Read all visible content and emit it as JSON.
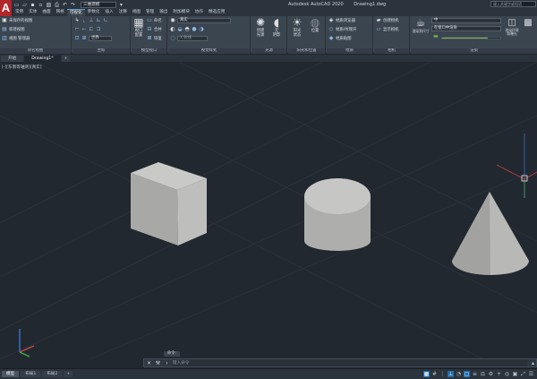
{
  "title_bar": {
    "app_logo": "A",
    "workspace": "三维建模",
    "app_name": "Autodesk AutoCAD 2020",
    "file_name": "Drawing1.dwg",
    "search_placeholder": "键入关键字或短语"
  },
  "ribbon_tabs": [
    "常用",
    "实体",
    "曲面",
    "网格",
    "可视化",
    "参数化",
    "插入",
    "注释",
    "视图",
    "管理",
    "输出",
    "附加模块",
    "协作",
    "精选应用"
  ],
  "active_ribbon_tab": "可视化",
  "panels": {
    "named_views": {
      "title": "命名视图",
      "unsaved_view": "未保存的视图",
      "new_view": "新建视图",
      "view_manager": "视图 管理器"
    },
    "coordinates": {
      "title": "坐标",
      "ucs_world": "世界"
    },
    "model_viewports": {
      "title": "模型视口",
      "configure": "视口\n配置",
      "named": "命名",
      "join": "合并",
      "restore": "恢复"
    },
    "visual_styles": {
      "title": "视觉样式",
      "style": "真实",
      "xray_placeholder": "X 射线"
    },
    "lights": {
      "title": "光源",
      "create_light": "创建\n光源",
      "no_shadow": "无\n阴影"
    },
    "sun_location": {
      "title": "阳光和位置",
      "sun_status": "阳光\n状态",
      "location": "位置"
    },
    "materials": {
      "title": "材质",
      "browser": "材质浏览器",
      "off": "材质/纹理开",
      "mapping": "材质贴图"
    },
    "camera": {
      "title": "相机",
      "create": "创建相机",
      "show": "显示相机"
    },
    "render": {
      "title": "渲染",
      "render_size": "渲染到尺寸",
      "preset": "中",
      "viewport_render": "在窗口中渲染",
      "render_env": "渲染环境\n和曝光",
      "progress_fraction": 0.78
    }
  },
  "file_tabs": [
    "开始",
    "Drawing1*"
  ],
  "active_file_tab": "Drawing1*",
  "viewport_label": "[-][东南等轴测][真实]",
  "command_line": {
    "history_label": "命令:",
    "placeholder": "键入命令"
  },
  "layout_tabs": [
    "模型",
    "布局1",
    "布局2"
  ],
  "active_layout_tab": "模型",
  "colors": {
    "viewport_bg": "#212830",
    "ribbon_bg": "#3b4550",
    "solid_shade": "#b8b9b6",
    "autocad_red": "#b2262a"
  }
}
